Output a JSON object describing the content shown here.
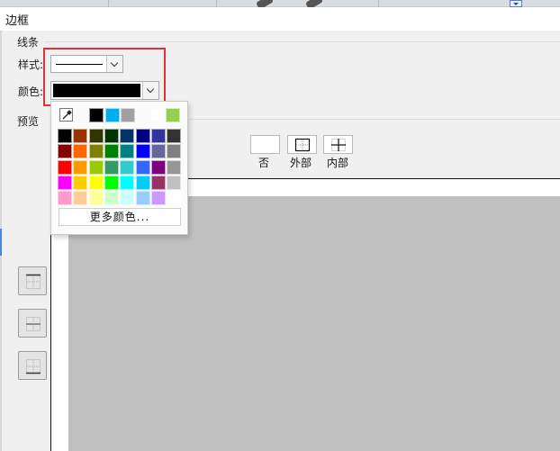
{
  "window": {
    "title": "边框"
  },
  "lines": {
    "group_label": "线条",
    "style_label": "样式:",
    "color_label": "颜色:",
    "color_value": "#000000"
  },
  "preview": {
    "group_label": "预览",
    "presets": [
      {
        "name": "preset-none",
        "label": "否"
      },
      {
        "name": "preset-outside",
        "label": "外部"
      },
      {
        "name": "preset-inside",
        "label": "内部"
      }
    ]
  },
  "palette": {
    "recent": [
      "#000000",
      "#00aeef",
      "#a0a0a0",
      "#ffffff",
      "#92d050"
    ],
    "grid": [
      [
        "#000000",
        "#993300",
        "#333300",
        "#003300",
        "#003366",
        "#000080",
        "#333399",
        "#333333"
      ],
      [
        "#800000",
        "#ff6600",
        "#808000",
        "#008000",
        "#008080",
        "#0000ff",
        "#666699",
        "#808080"
      ],
      [
        "#ff0000",
        "#ff9900",
        "#99cc00",
        "#339966",
        "#33cccc",
        "#3366ff",
        "#800080",
        "#969696"
      ],
      [
        "#ff00ff",
        "#ffcc00",
        "#ffff00",
        "#00ff00",
        "#00ffff",
        "#00ccff",
        "#993366",
        "#c0c0c0"
      ],
      [
        "#ff99cc",
        "#ffcc99",
        "#ffff99",
        "#ccffcc",
        "#ccffff",
        "#99ccff",
        "#cc99ff",
        "#ffffff"
      ]
    ],
    "more_label": "更多颜色..."
  },
  "colors": {
    "highlight": "#e0303a",
    "preview_gray": "#c0c0c0"
  }
}
